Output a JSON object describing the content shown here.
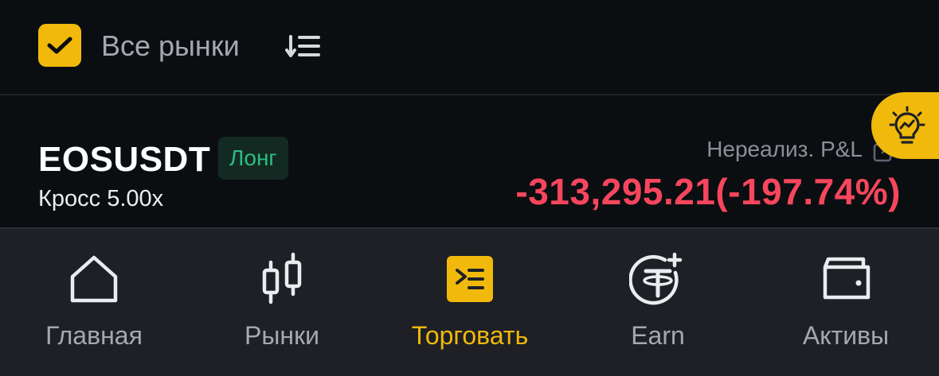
{
  "filter": {
    "checked": true,
    "label": "Все рынки"
  },
  "position": {
    "symbol": "EOSUSDT",
    "side": "Лонг",
    "margin_mode": "Кросс 5.00x",
    "pnl_label": "Нереализ. P&L",
    "pnl_value": "-313,295.21(-197.74%)"
  },
  "nav": {
    "items": [
      {
        "label": "Главная",
        "icon": "home-icon"
      },
      {
        "label": "Рынки",
        "icon": "candlestick-icon"
      },
      {
        "label": "Торговать",
        "icon": "trade-icon",
        "active": true
      },
      {
        "label": "Earn",
        "icon": "tether-plus-icon"
      },
      {
        "label": "Активы",
        "icon": "wallet-icon"
      }
    ]
  },
  "colors": {
    "accent": "#f0b90b",
    "loss": "#f6465d",
    "long": "#2ebd85",
    "background": "#0b0e11",
    "nav_background": "#1e2026"
  }
}
